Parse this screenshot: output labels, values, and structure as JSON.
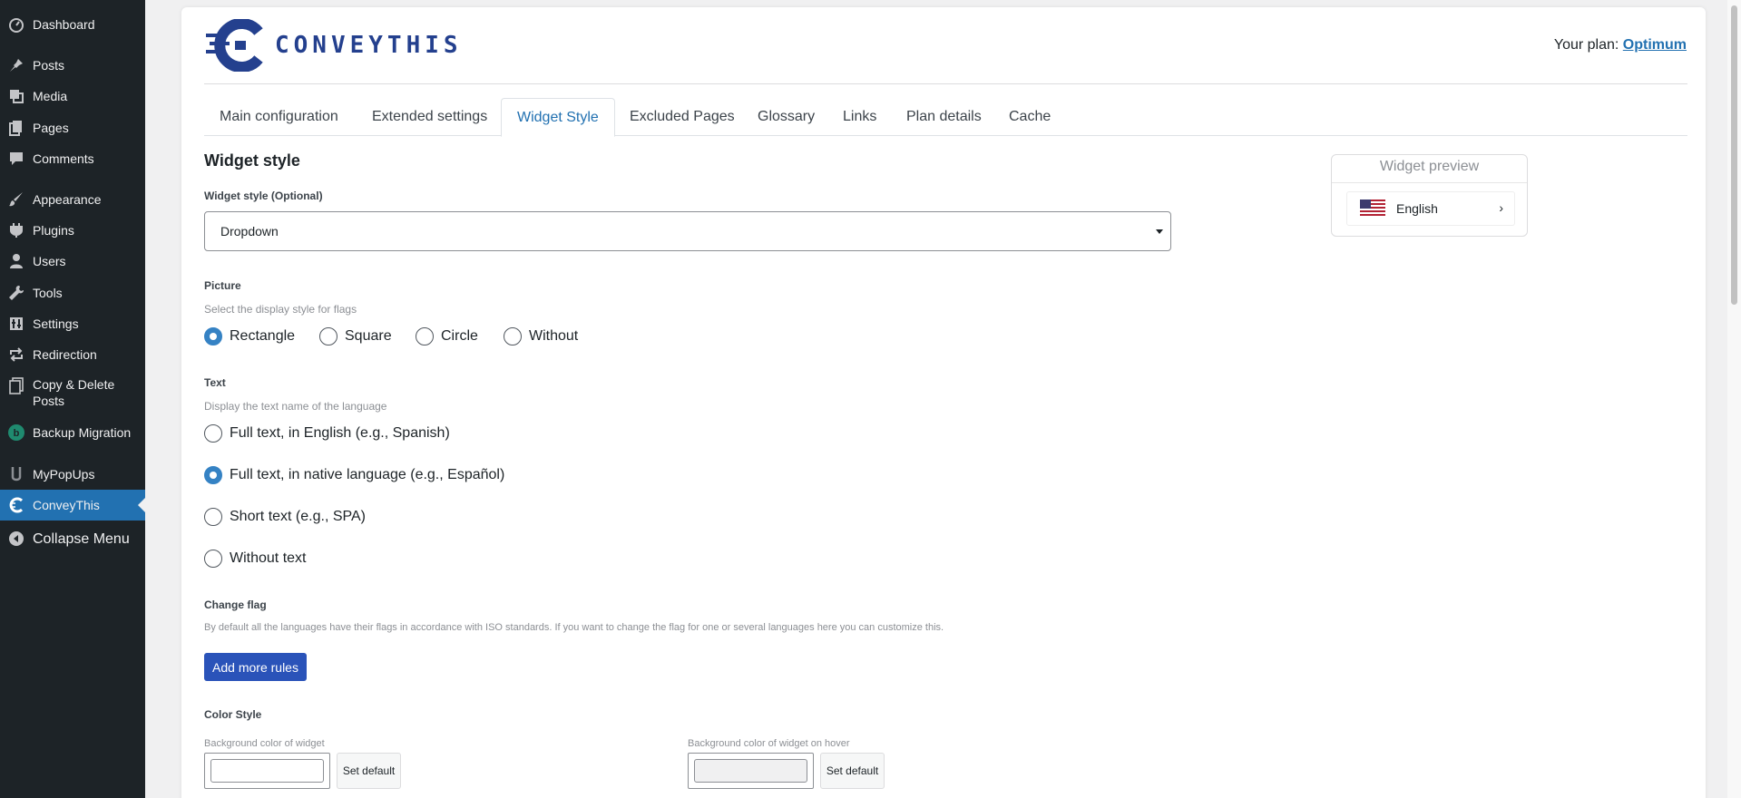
{
  "sidebar": {
    "items": [
      {
        "label": "Dashboard",
        "icon": "dashboard-icon"
      },
      {
        "label": "Posts",
        "icon": "pin-icon"
      },
      {
        "label": "Media",
        "icon": "media-icon"
      },
      {
        "label": "Pages",
        "icon": "pages-icon"
      },
      {
        "label": "Comments",
        "icon": "comment-icon"
      },
      {
        "label": "Appearance",
        "icon": "brush-icon"
      },
      {
        "label": "Plugins",
        "icon": "plugin-icon"
      },
      {
        "label": "Users",
        "icon": "user-icon"
      },
      {
        "label": "Tools",
        "icon": "wrench-icon"
      },
      {
        "label": "Settings",
        "icon": "settings-icon"
      },
      {
        "label": "Redirection",
        "icon": "redirect-icon"
      },
      {
        "label": "Copy & Delete",
        "label2": "Posts",
        "icon": "copy-icon"
      },
      {
        "label": "Backup Migration",
        "icon": "backup-icon"
      },
      {
        "label": "MyPopUps",
        "icon": "popup-icon"
      },
      {
        "label": "ConveyThis",
        "icon": "conveythis-icon"
      },
      {
        "label": "Collapse Menu",
        "icon": "collapse-icon"
      }
    ]
  },
  "header": {
    "logo_text": "CONVEYTHIS",
    "plan_prefix": "Your plan:",
    "plan_name": "Optimum"
  },
  "tabs": [
    {
      "label": "Main configuration"
    },
    {
      "label": "Extended settings"
    },
    {
      "label": "Widget Style"
    },
    {
      "label": "Excluded Pages"
    },
    {
      "label": "Glossary"
    },
    {
      "label": "Links"
    },
    {
      "label": "Plan details"
    },
    {
      "label": "Cache"
    }
  ],
  "content": {
    "section_title": "Widget style",
    "style_label": "Widget style (Optional)",
    "style_value": "Dropdown",
    "picture": {
      "label": "Picture",
      "hint": "Select the display style for flags",
      "options": [
        "Rectangle",
        "Square",
        "Circle",
        "Without"
      ],
      "selected": "Rectangle"
    },
    "text": {
      "label": "Text",
      "hint": "Display the text name of the language",
      "options": [
        "Full text, in English (e.g., Spanish)",
        "Full text, in native language (e.g., Español)",
        "Short text (e.g., SPA)",
        "Without text"
      ],
      "selected": "Full text, in native language (e.g., Español)"
    },
    "change_flag": {
      "label": "Change flag",
      "hint": "By default all the languages have their flags in accordance with ISO standards. If you want to change the flag for one or several languages here you can customize this.",
      "button": "Add more rules"
    },
    "color_style": {
      "label": "Color Style",
      "bg_label": "Background color of widget",
      "bg_hover_label": "Background color of widget on hover",
      "set_default": "Set default"
    }
  },
  "preview": {
    "title": "Widget preview",
    "language": "English"
  },
  "colors": {
    "sidebar_bg": "#1d2327",
    "accent": "#2271b1",
    "button_primary": "#2a53b9",
    "logo_blue": "#24408e"
  }
}
